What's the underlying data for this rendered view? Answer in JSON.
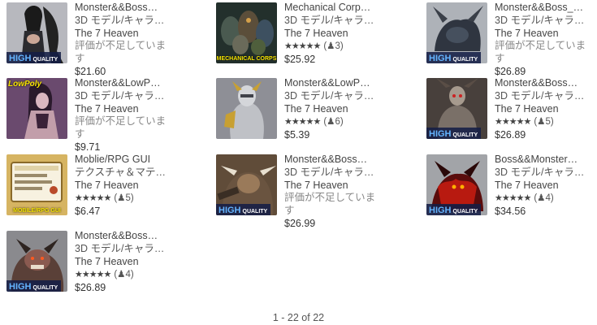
{
  "items": [
    {
      "title": "Monster&&Boss…",
      "category": "3D モデル/キャラ…",
      "publisher": "The 7 Heaven",
      "rating_text": "評価が不足しています",
      "price": "$21.60",
      "badge_big": "HIGH",
      "badge_small": "QUALITY",
      "image_icon": "dark-angel-character-thumbnail"
    },
    {
      "title": "Mechanical Corp…",
      "category": "3D モデル/キャラ…",
      "publisher": "The 7 Heaven",
      "stars": "★★★★★",
      "rating_count": "(♟3)",
      "price": "$25.92",
      "bottom_label": "MECHANICAL CORPS",
      "image_icon": "mech-robots-thumbnail"
    },
    {
      "title": "Monster&&Boss_…",
      "category": "3D モデル/キャラ…",
      "publisher": "The 7 Heaven",
      "rating_text": "評価が不足しています",
      "price": "$26.89",
      "badge_big": "HIGH",
      "badge_small": "QUALITY",
      "image_icon": "horned-beast-thumbnail"
    },
    {
      "title": "Monster&&LowP…",
      "category": "3D モデル/キャラ…",
      "publisher": "The 7 Heaven",
      "rating_text": "評価が不足しています",
      "price": "$9.71",
      "corner_label": "LowPoly",
      "image_icon": "lowpoly-female-thumbnail"
    },
    {
      "title": "Monster&&LowP…",
      "category": "3D モデル/キャラ…",
      "publisher": "The 7 Heaven",
      "stars": "★★★★★",
      "rating_count": "(♟6)",
      "price": "$5.39",
      "image_icon": "armored-knight-thumbnail"
    },
    {
      "title": "Monster&&Boss…",
      "category": "3D モデル/キャラ…",
      "publisher": "The 7 Heaven",
      "stars": "★★★★★",
      "rating_count": "(♟5)",
      "price": "$26.89",
      "badge_big": "HIGH",
      "badge_small": "QUALITY",
      "image_icon": "skeleton-warrior-thumbnail"
    },
    {
      "title": "Moblie/RPG GUI",
      "category": "テクスチャ＆マテ…",
      "publisher": "The 7 Heaven",
      "stars": "★★★★★",
      "rating_count": "(♟5)",
      "price": "$6.47",
      "bottom_label": "MOBILE/RPG GUI",
      "image_icon": "gui-panel-thumbnail"
    },
    {
      "title": "Monster&&Boss…",
      "category": "3D モデル/キャラ…",
      "publisher": "The 7 Heaven",
      "rating_text": "評価が不足しています",
      "price": "$26.99",
      "badge_big": "HIGH",
      "badge_small": "QUALITY",
      "image_icon": "ogre-boss-thumbnail"
    },
    {
      "title": "Boss&&Monster…",
      "category": "3D モデル/キャラ…",
      "publisher": "The 7 Heaven",
      "stars": "★★★★★",
      "rating_count": "(♟4)",
      "price": "$34.56",
      "badge_big": "HIGH",
      "badge_small": "QUALITY",
      "image_icon": "fire-demon-thumbnail"
    },
    {
      "title": "Monster&&Boss…",
      "category": "3D モデル/キャラ…",
      "publisher": "The 7 Heaven",
      "stars": "★★★★★",
      "rating_count": "(♟4)",
      "price": "$26.89",
      "badge_big": "HIGH",
      "badge_small": "QUALITY",
      "image_icon": "beast-monster-thumbnail"
    }
  ],
  "pagination": {
    "text": "1 - 22 of 22"
  },
  "colors": {
    "badge_bg": "#141e46",
    "badge_text": "#64b4ff",
    "label_yellow": "#f7e500"
  }
}
